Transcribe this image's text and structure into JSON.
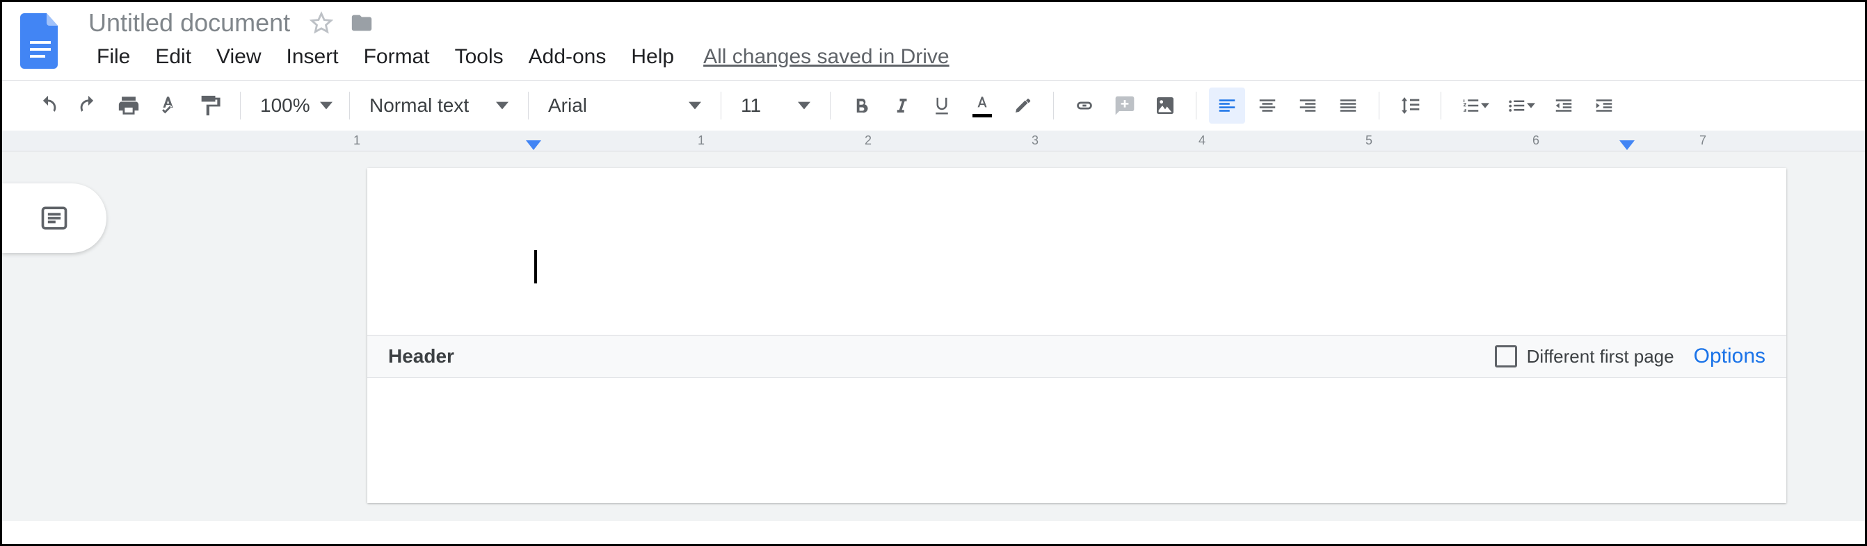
{
  "header": {
    "doc_title": "Untitled document",
    "save_status": "All changes saved in Drive"
  },
  "menus": {
    "file": "File",
    "edit": "Edit",
    "view": "View",
    "insert": "Insert",
    "format": "Format",
    "tools": "Tools",
    "addons": "Add-ons",
    "help": "Help"
  },
  "toolbar": {
    "zoom": "100%",
    "paragraph_style": "Normal text",
    "font": "Arial",
    "font_size": "11"
  },
  "ruler": {
    "labels": [
      "1",
      "1",
      "2",
      "3",
      "4",
      "5",
      "6",
      "7"
    ]
  },
  "header_section": {
    "label": "Header",
    "different_first_page": "Different first page",
    "options": "Options"
  },
  "colors": {
    "brand": "#4285f4",
    "accent": "#1a73e8"
  }
}
